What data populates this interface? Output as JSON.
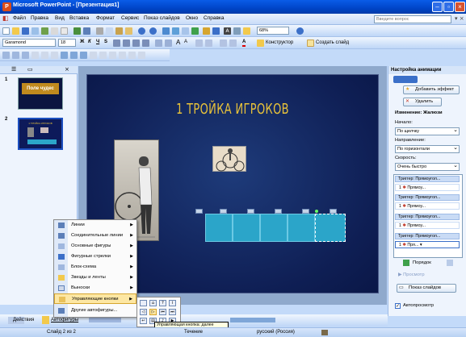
{
  "window": {
    "title": "Microsoft PowerPoint - [Презентация1]",
    "app_letter": "P"
  },
  "menubar": {
    "items": [
      "Файл",
      "Правка",
      "Вид",
      "Вставка",
      "Формат",
      "Сервис",
      "Показ слайдов",
      "Окно",
      "Справка"
    ],
    "help_placeholder": "Введите вопрос"
  },
  "toolbar": {
    "zoom": "68%",
    "font_name": "Garamond",
    "font_size": "18",
    "bold": "Ж",
    "italic": "К",
    "underline": "Ч",
    "shadow": "S",
    "designer": "Конструктор",
    "new_slide": "Создать слайд"
  },
  "slides_panel": {
    "slides": [
      {
        "number": "1",
        "title": "Поле чудес"
      },
      {
        "number": "2",
        "title": "1 ТРОЙКА ИГРОКОВ"
      }
    ]
  },
  "slide": {
    "title": "1 ТРОЙКА ИГРОКОВ"
  },
  "task_pane": {
    "title": "Настройка анимации",
    "add_effect": "Добавить эффект",
    "remove": "Удалить",
    "change_label": "Изменение: Жалюзи",
    "start_label": "Начало:",
    "start_value": "По щелчку",
    "direction_label": "Направление:",
    "direction_value": "По горизонтали",
    "speed_label": "Скорость:",
    "speed_value": "Очень быстро",
    "triggers": [
      {
        "head": "Триггер: Прямоугол...",
        "item": "Прямоу..."
      },
      {
        "head": "Триггер: Прямоугол...",
        "item": "Прямоу..."
      },
      {
        "head": "Триггер: Прямоугол...",
        "item": "Прямоу..."
      },
      {
        "head": "Триггер: Прямоугол...",
        "item": "Пря..."
      }
    ],
    "order_label": "Порядок",
    "preview": "Просмотр",
    "slideshow": "Показ слайдов",
    "autopreview": "Автопросмотр"
  },
  "autoshapes_menu": {
    "items": [
      {
        "label": "Линии",
        "icon": "lines-icon",
        "submenu": true
      },
      {
        "label": "Соединительные линии",
        "icon": "connectors-icon",
        "submenu": true
      },
      {
        "label": "Основные фигуры",
        "icon": "basic-shapes-icon",
        "submenu": true
      },
      {
        "label": "Фигурные стрелки",
        "icon": "block-arrows-icon",
        "submenu": true
      },
      {
        "label": "Блок-схема",
        "icon": "flowchart-icon",
        "submenu": true
      },
      {
        "label": "Звезды и ленты",
        "icon": "stars-icon",
        "submenu": true
      },
      {
        "label": "Выноски",
        "icon": "callouts-icon",
        "submenu": true
      },
      {
        "label": "Управляющие кнопки",
        "icon": "action-buttons-icon",
        "submenu": true
      },
      {
        "label": "Другие автофигуры...",
        "icon": "more-shapes-icon",
        "submenu": false
      }
    ]
  },
  "tooltip": "Управляющая кнопка: далее",
  "drawing_bar": {
    "actions": "Действия",
    "autoshapes": "Автофигуры"
  },
  "statusbar": {
    "slide": "Слайд 2 из 2",
    "design": "Течение",
    "language": "русский (Россия)"
  }
}
